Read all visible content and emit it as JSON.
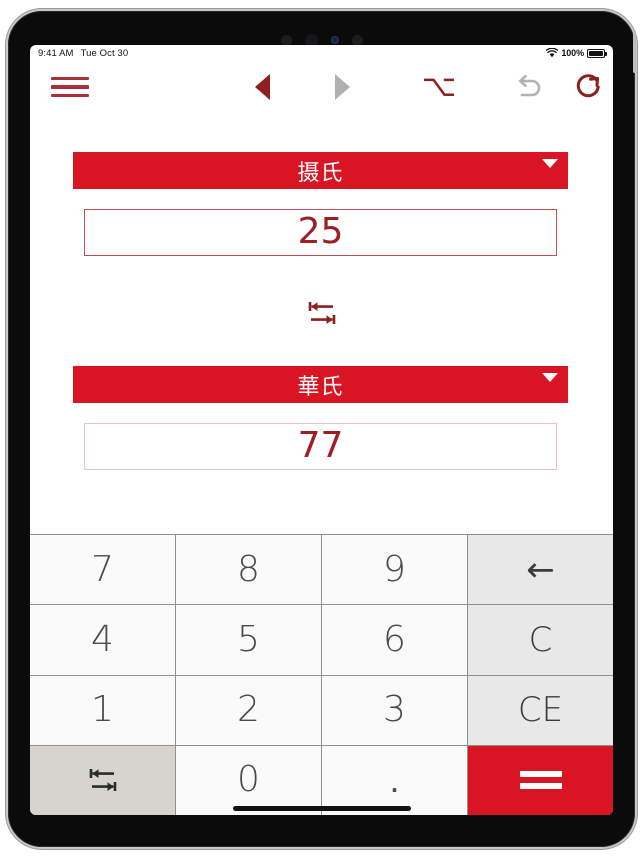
{
  "status_bar": {
    "time": "9:41 AM",
    "date": "Tue Oct 30",
    "battery_percent": "100%",
    "wifi_icon": "wifi-icon",
    "battery_icon": "battery-icon"
  },
  "toolbar": {
    "menu_icon": "hamburger-menu-icon",
    "back_icon": "back-triangle-icon",
    "forward_icon": "forward-triangle-icon",
    "option_glyph": "⌥",
    "undo_icon": "undo-arrow-icon",
    "redo_icon": "redo-circular-arrow-icon"
  },
  "converter": {
    "from": {
      "unit_label": "摄氏",
      "value": "25",
      "caret_icon": "chevron-down-icon"
    },
    "to": {
      "unit_label": "華氏",
      "value": "77",
      "caret_icon": "chevron-down-icon"
    },
    "swap_icon": "swap-arrows-icon"
  },
  "keypad": {
    "keys": [
      {
        "label": "7",
        "name": "key-7",
        "kind": "num"
      },
      {
        "label": "8",
        "name": "key-8",
        "kind": "num"
      },
      {
        "label": "9",
        "name": "key-9",
        "kind": "num"
      },
      {
        "label": "←",
        "name": "key-backspace",
        "kind": "fn"
      },
      {
        "label": "4",
        "name": "key-4",
        "kind": "num"
      },
      {
        "label": "5",
        "name": "key-5",
        "kind": "num"
      },
      {
        "label": "6",
        "name": "key-6",
        "kind": "num"
      },
      {
        "label": "C",
        "name": "key-clear",
        "kind": "fn"
      },
      {
        "label": "1",
        "name": "key-1",
        "kind": "num"
      },
      {
        "label": "2",
        "name": "key-2",
        "kind": "num"
      },
      {
        "label": "3",
        "name": "key-3",
        "kind": "num"
      },
      {
        "label": "CE",
        "name": "key-clear-entry",
        "kind": "fn"
      },
      {
        "label": "",
        "name": "key-swap",
        "kind": "swap"
      },
      {
        "label": "0",
        "name": "key-0",
        "kind": "num"
      },
      {
        "label": ".",
        "name": "key-decimal",
        "kind": "dot"
      },
      {
        "label": "=",
        "name": "key-equals",
        "kind": "eq"
      }
    ]
  },
  "colors": {
    "accent_red": "#d91523",
    "dark_red": "#8e2020",
    "value_red": "#9d1f25",
    "key_face": "#fafafa",
    "key_fn": "#e8e8e8",
    "key_swap": "#d5d5cd"
  }
}
